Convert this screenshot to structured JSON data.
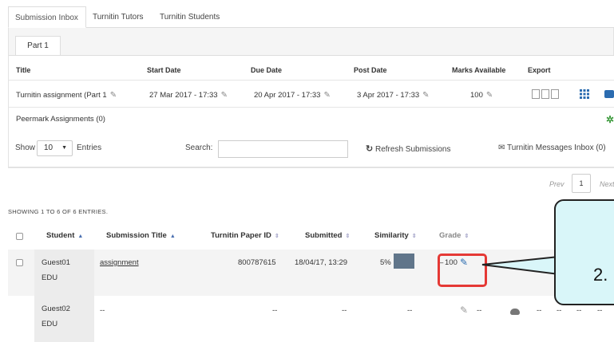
{
  "top_tabs": [
    "Submission Inbox",
    "Turnitin Tutors",
    "Turnitin Students"
  ],
  "part_tab": "Part 1",
  "assignment_table": {
    "headers": [
      "Title",
      "Start Date",
      "Due Date",
      "Post Date",
      "Marks Available",
      "Export"
    ],
    "title": "Turnitin assignment (Part 1",
    "start_date": "27 Mar 2017 - 17:33",
    "due_date": "20 Apr 2017 - 17:33",
    "post_date": "3 Apr 2017 - 17:33",
    "marks": "100"
  },
  "peermark": "Peermark Assignments (0)",
  "controls": {
    "show_label": "Show",
    "entries_value": "10",
    "entries_label": "Entries",
    "search_label": "Search:",
    "refresh": "Refresh Submissions",
    "messages": "Turnitin Messages Inbox (0)"
  },
  "pagination": {
    "prev": "Prev",
    "current": "1",
    "next": "Next"
  },
  "showing": "SHOWING 1 TO 6 OF 6 ENTRIES.",
  "submissions": {
    "headers": [
      "Student",
      "Submission Title",
      "Turnitin Paper ID",
      "Submitted",
      "Similarity",
      "Grade"
    ],
    "rows": [
      {
        "name1": "Guest01",
        "name2": "EDU",
        "title": "assignment",
        "paper_id": "800787615",
        "submitted": "18/04/17, 13:29",
        "similarity": "5%",
        "grade_prefix": "–",
        "grade": "100"
      },
      {
        "name1": "Guest02",
        "name2": "EDU",
        "title": "--",
        "paper_id": "--",
        "submitted": "--",
        "similarity": "--",
        "grade": "--",
        "extra1": "--",
        "extra2": "--",
        "extra3": "--",
        "extra4": "--"
      }
    ]
  },
  "callout": {
    "text": "2."
  },
  "colors": {
    "highlight": "#e53935",
    "callout_bg": "#d9f6f9",
    "accent": "#4a6fb0",
    "success": "#3c9a3c"
  }
}
